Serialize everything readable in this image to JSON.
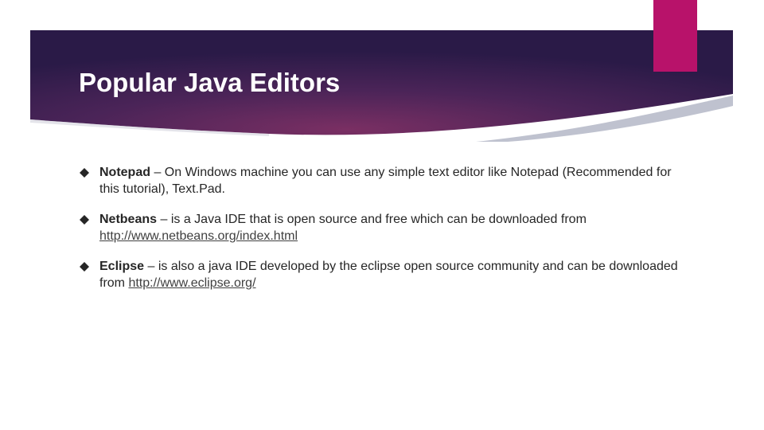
{
  "slide": {
    "title": "Popular Java Editors",
    "colors": {
      "banner_dark": "#2c1b4a",
      "banner_mid": "#6b2a5e",
      "accent": "#b8126a",
      "text": "#262626"
    },
    "bullets": [
      {
        "term": "Notepad",
        "text": " – On Windows machine you can use any simple text editor like Notepad (Recommended for this tutorial), Text.Pad.",
        "link": ""
      },
      {
        "term": "Netbeans",
        "text": " – is a Java IDE that is open source and free which can be downloaded from ",
        "link": "http://www.netbeans.org/index.html"
      },
      {
        "term": "Eclipse",
        "text": " – is also a java IDE developed by the eclipse open source community and can be downloaded from ",
        "link": "http://www.eclipse.org/"
      }
    ],
    "bullet_icon": "diamond-icon"
  }
}
